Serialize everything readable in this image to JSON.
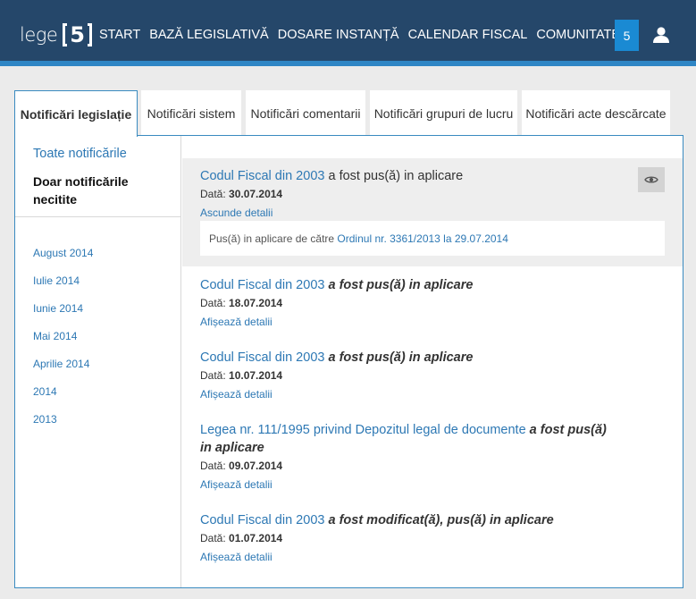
{
  "header": {
    "logo_text": "lege",
    "logo_number": "5",
    "nav": [
      "START",
      "BAZĂ LEGISLATIVĂ",
      "DOSARE INSTANȚĂ",
      "CALENDAR FISCAL",
      "COMUNITATE"
    ],
    "badge_count": "5",
    "colors": {
      "bar": "#25476a",
      "accent": "#2f86c5",
      "badge": "#1a8ad3"
    }
  },
  "tabs": [
    {
      "label": "Notificări legislație",
      "active": true
    },
    {
      "label": "Notificări sistem",
      "active": false
    },
    {
      "label": "Notificări comentarii",
      "active": false
    },
    {
      "label": "Notificări grupuri de lucru",
      "active": false
    },
    {
      "label": "Notificări acte descărcate",
      "active": false
    }
  ],
  "sidebar": {
    "filter_all": "Toate notificările",
    "filter_unread": "Doar notificările necitite",
    "months": [
      "August 2014",
      "Iulie 2014",
      "Iunie 2014",
      "Mai 2014",
      "Aprilie 2014",
      "2014",
      "2013"
    ]
  },
  "notifications": [
    {
      "act": "Codul Fiscal din 2003",
      "action": "a fost pus(ă) in aplicare",
      "date_label": "Dată:",
      "date": "30.07.2014",
      "toggle": "Ascunde detalii",
      "expanded": true,
      "detail": {
        "prefix": "Pus(ă) in aplicare",
        "by": "de către",
        "link": "Ordinul nr. 3361/2013 la 29.07.2014"
      }
    },
    {
      "act": "Codul Fiscal din 2003",
      "action": "a fost pus(ă) in aplicare",
      "date_label": "Dată:",
      "date": "18.07.2014",
      "toggle": "Afișează detalii"
    },
    {
      "act": "Codul Fiscal din 2003",
      "action": "a fost pus(ă) in aplicare",
      "date_label": "Dată:",
      "date": "10.07.2014",
      "toggle": "Afișează detalii"
    },
    {
      "act": "Legea nr. 111/1995 privind Depozitul legal de documente",
      "action": "a fost pus(ă) in aplicare",
      "date_label": "Dată:",
      "date": "09.07.2014",
      "toggle": "Afișează detalii"
    },
    {
      "act": "Codul Fiscal din 2003",
      "action": "a fost modificat(ă), pus(ă) in aplicare",
      "date_label": "Dată:",
      "date": "01.07.2014",
      "toggle": "Afișează detalii"
    }
  ]
}
